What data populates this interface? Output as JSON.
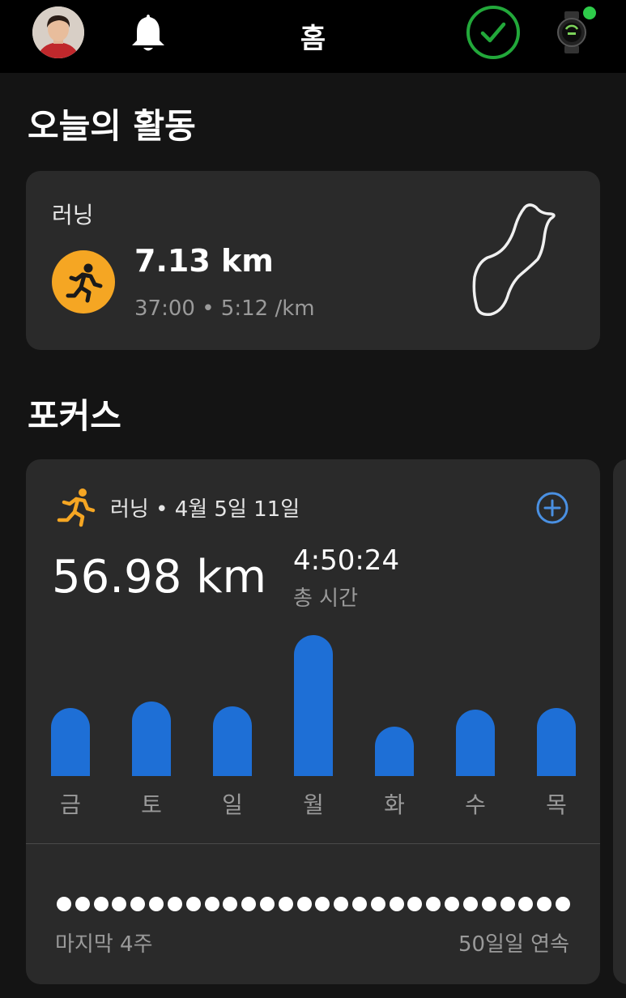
{
  "header": {
    "title": "홈",
    "icons": {
      "avatar": "avatar",
      "notifications": "bell-icon",
      "status": "check-circle-icon",
      "device": "watch-icon"
    },
    "device_status_color": "#2ecc4a",
    "check_color": "#22a83a"
  },
  "today": {
    "section_title": "오늘의 활동",
    "activity": {
      "sport": "러닝",
      "distance": "7.13 km",
      "meta": "37:00 • 5:12 /km",
      "icon": "running-icon",
      "icon_color": "#f5a623",
      "route_icon": "route-map-icon"
    }
  },
  "focus": {
    "section_title": "포커스",
    "card": {
      "header": "러닝 • 4월 5일 11일",
      "icon": "running-icon",
      "add_icon": "plus-circle-icon",
      "total_distance": "56.98 km",
      "total_time": "4:50:24",
      "total_time_label": "총 시간",
      "bar_color": "#1e6fd6",
      "chart_data": {
        "type": "bar",
        "categories": [
          "금",
          "토",
          "일",
          "월",
          "화",
          "수",
          "목"
        ],
        "values": [
          7.5,
          8.2,
          7.7,
          15.5,
          5.4,
          7.3,
          7.5
        ]
      },
      "streak": {
        "dots_filled": 28,
        "left_label": "마지막 4주",
        "right_label": "50일일 연속"
      }
    }
  }
}
